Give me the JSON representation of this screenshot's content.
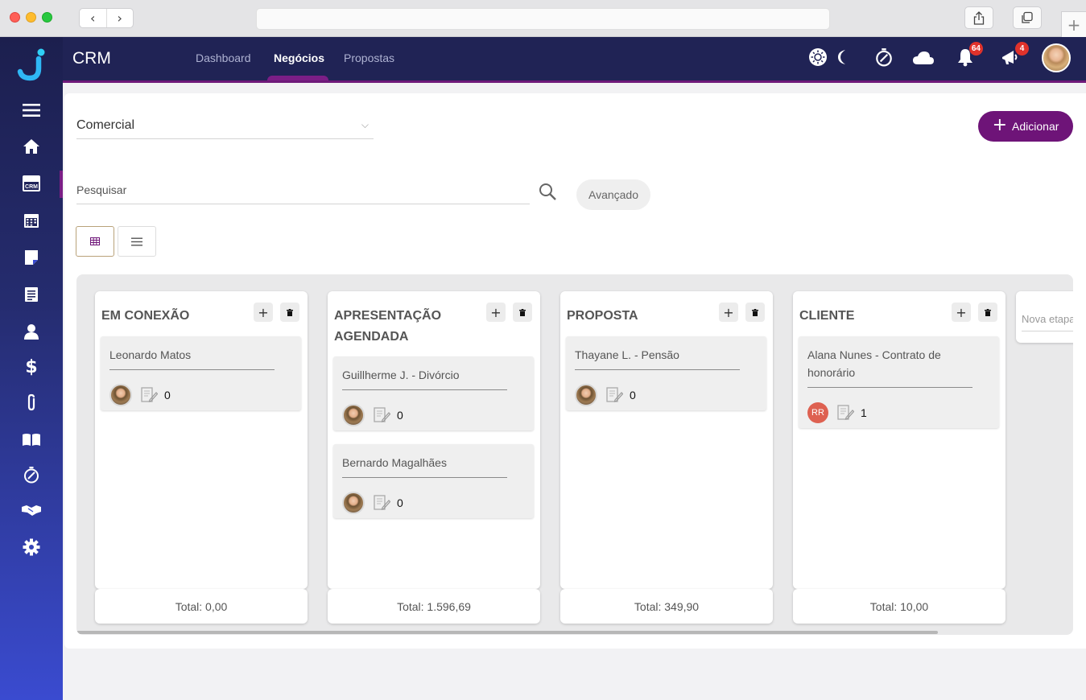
{
  "browser": {
    "back_icon": "chevron-left-icon",
    "forward_icon": "chevron-right-icon",
    "url": ""
  },
  "sidebar": {
    "items": [
      {
        "name": "menu",
        "icon": "hamburger-icon"
      },
      {
        "name": "home",
        "icon": "home-icon"
      },
      {
        "name": "crm",
        "icon": "crm-icon",
        "active": true
      },
      {
        "name": "calendar",
        "icon": "calendar-icon"
      },
      {
        "name": "documents",
        "icon": "document-icon"
      },
      {
        "name": "reports",
        "icon": "report-icon"
      },
      {
        "name": "contacts",
        "icon": "person-icon"
      },
      {
        "name": "finance",
        "icon": "dollar-icon"
      },
      {
        "name": "attachments",
        "icon": "paperclip-icon"
      },
      {
        "name": "library",
        "icon": "book-icon"
      },
      {
        "name": "timer",
        "icon": "stopwatch-icon"
      },
      {
        "name": "deals",
        "icon": "handshake-icon"
      },
      {
        "name": "settings",
        "icon": "gear-icon"
      }
    ]
  },
  "header": {
    "title": "CRM",
    "tabs": [
      {
        "label": "Dashboard",
        "active": false
      },
      {
        "label": "Negócios",
        "active": true
      },
      {
        "label": "Propostas",
        "active": false
      }
    ],
    "notifications_count": "64",
    "announcements_count": "4"
  },
  "toolbar": {
    "pipeline_value": "Comercial",
    "add_label": "Adicionar",
    "search_placeholder": "Pesquisar",
    "advanced_label": "Avançado"
  },
  "board": {
    "columns": [
      {
        "title": "EM CONEXÃO",
        "total": "Total: 0,00",
        "deals": [
          {
            "title": "Leonardo Matos",
            "notes": "0",
            "owner": "photo"
          }
        ]
      },
      {
        "title": "APRESENTAÇÃO AGENDADA",
        "total": "Total: 1.596,69",
        "deals": [
          {
            "title": "Guillherme J. - Divórcio",
            "notes": "0",
            "owner": "photo"
          },
          {
            "title": "Bernardo Magalhães",
            "notes": "0",
            "owner": "photo"
          }
        ]
      },
      {
        "title": "PROPOSTA",
        "total": "Total: 349,90",
        "deals": [
          {
            "title": "Thayane L. - Pensão",
            "notes": "0",
            "owner": "photo"
          }
        ]
      },
      {
        "title": "CLIENTE",
        "total": "Total: 10,00",
        "deals": [
          {
            "title": "Alana Nunes - Contrato de honorário",
            "notes": "1",
            "owner": "RR"
          }
        ]
      }
    ],
    "new_stage_placeholder": "Nova etapa"
  },
  "colors": {
    "sidebar_top": "#1c1f4e",
    "sidebar_bottom": "#3a4bd0",
    "appbar": "#202355",
    "accent": "#6e1478",
    "initials_avatar": "#de6151",
    "notification_badge": "#e0322b"
  }
}
